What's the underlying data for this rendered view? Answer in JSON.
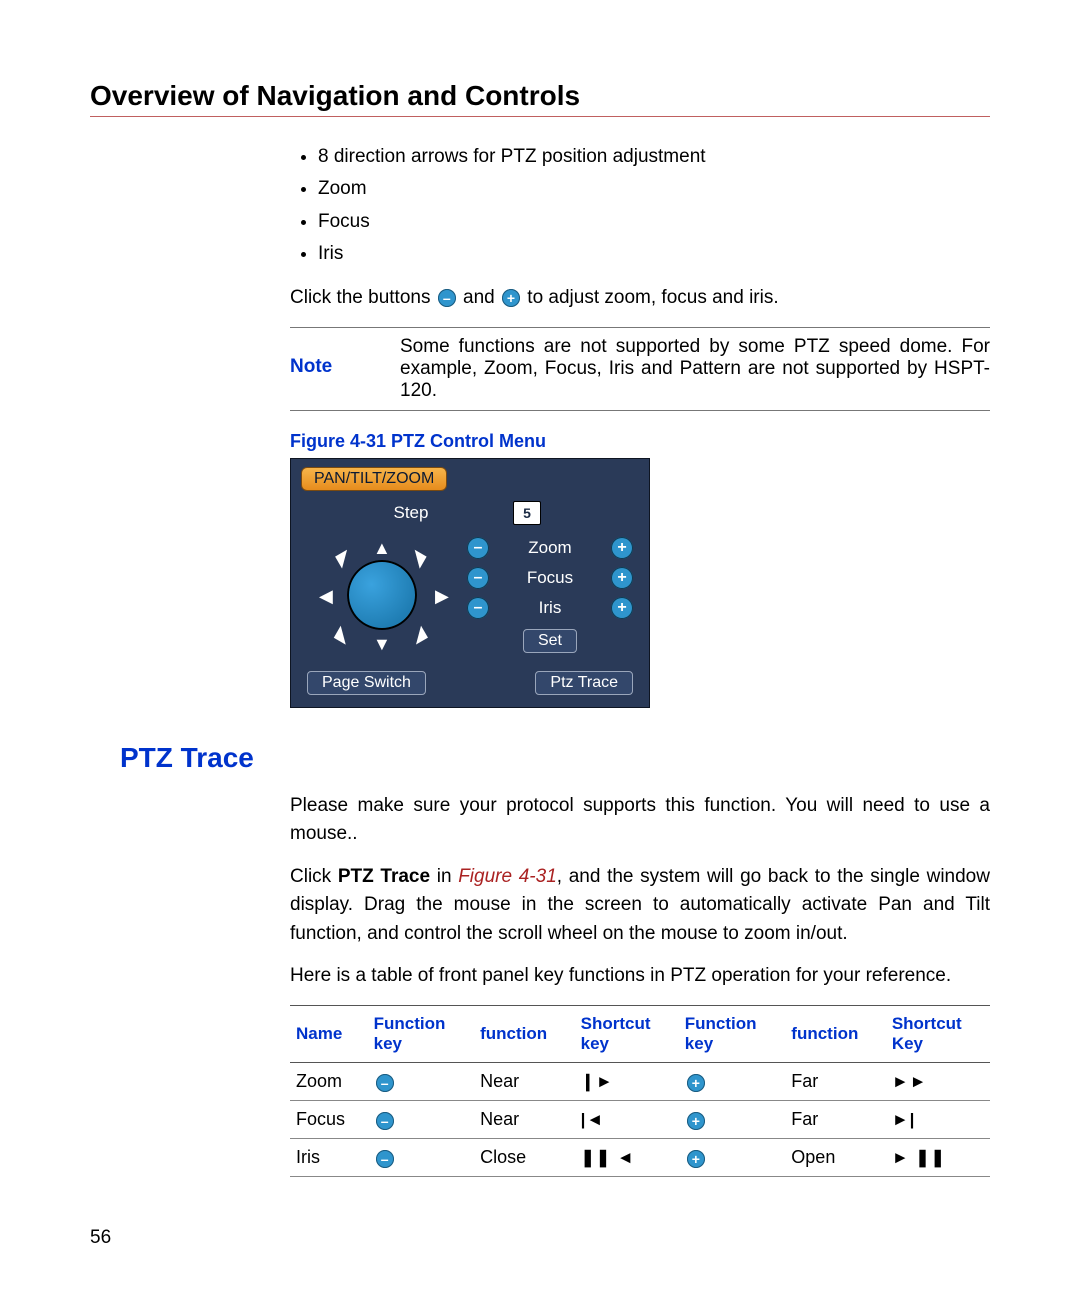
{
  "header": "Overview of Navigation and Controls",
  "bullets": [
    "8 direction arrows for PTZ position adjustment",
    "Zoom",
    "Focus",
    "Iris"
  ],
  "click_line": {
    "pre": "Click the buttons ",
    "mid": " and ",
    "post": " to adjust zoom, focus and iris."
  },
  "note": {
    "label": "Note",
    "text": "Some functions are not supported by some PTZ speed dome. For example, Zoom, Focus, Iris and Pattern are not supported by HSPT-120."
  },
  "figure_caption": "Figure 4-31 PTZ Control Menu",
  "panel": {
    "tab": "PAN/TILT/ZOOM",
    "step_label": "Step",
    "step_value": "5",
    "rows": [
      {
        "minus": "–",
        "label": "Zoom",
        "plus": "+"
      },
      {
        "minus": "–",
        "label": "Focus",
        "plus": "+"
      },
      {
        "minus": "–",
        "label": "Iris",
        "plus": "+"
      }
    ],
    "set_btn": "Set",
    "page_switch_btn": "Page Switch",
    "ptz_trace_btn": "Ptz Trace"
  },
  "section_title": "PTZ Trace",
  "para1": "Please make sure your protocol supports this function. You will need to use a mouse..",
  "para2_pre": "Click ",
  "para2_bold": "PTZ Trace",
  "para2_mid": " in ",
  "para2_ref": "Figure 4-31",
  "para2_post": ", and the system will go back to the single window display. Drag the mouse in the screen to automatically activate Pan and Tilt function, and control the scroll wheel on the mouse to zoom in/out.",
  "para3": "Here is a table of front panel key functions in PTZ operation for your reference.",
  "table": {
    "headers": [
      "Name",
      "Function key",
      "function",
      "Shortcut key",
      "Function key",
      "function",
      "Shortcut Key"
    ],
    "rows": [
      {
        "name": "Zoom",
        "fk1": "–",
        "fn1": "Near",
        "sk1": "❙►",
        "fk2": "+",
        "fn2": "Far",
        "sk2": "►►"
      },
      {
        "name": "Focus",
        "fk1": "–",
        "fn1": "Near",
        "sk1": "|◄",
        "fk2": "+",
        "fn2": "Far",
        "sk2": "►|"
      },
      {
        "name": "Iris",
        "fk1": "–",
        "fn1": "Close",
        "sk1": "❚❚ ◄",
        "fk2": "+",
        "fn2": "Open",
        "sk2": "► ❚❚"
      }
    ]
  },
  "page_number": "56"
}
